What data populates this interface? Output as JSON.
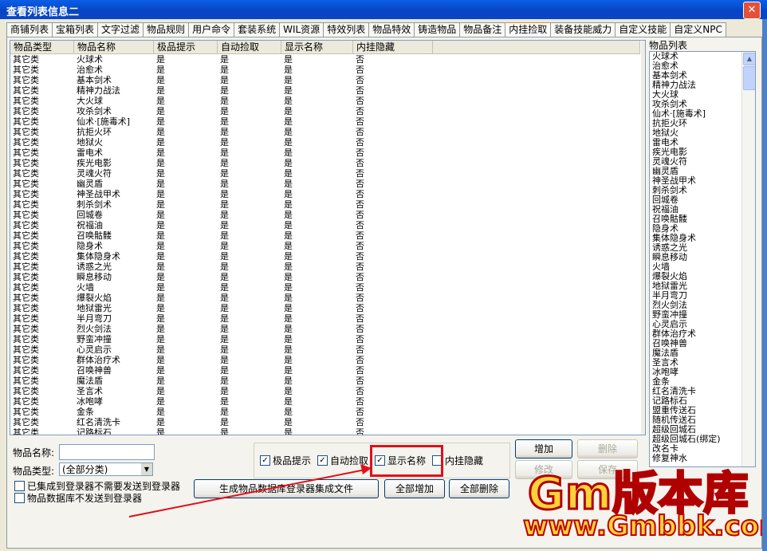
{
  "window": {
    "title": "查看列表信息二",
    "close_label": "✕"
  },
  "tabs": [
    "商铺列表",
    "宝箱列表",
    "文字过滤",
    "物品规则",
    "用户命令",
    "套装系统",
    "WIL资源",
    "特效列表",
    "物品特效",
    "铸造物品",
    "物品备注",
    "内挂捡取",
    "装备技能威力",
    "自定义技能",
    "自定义NPC"
  ],
  "active_tab": "内挂捡取",
  "table": {
    "columns": [
      "物品类型",
      "物品名称",
      "极品提示",
      "自动捡取",
      "显示名称",
      "内挂隐藏"
    ],
    "rows": [
      [
        "其它类",
        "火球术",
        "是",
        "是",
        "是",
        "否"
      ],
      [
        "其它类",
        "治愈术",
        "是",
        "是",
        "是",
        "否"
      ],
      [
        "其它类",
        "基本剑术",
        "是",
        "是",
        "是",
        "否"
      ],
      [
        "其它类",
        "精神力战法",
        "是",
        "是",
        "是",
        "否"
      ],
      [
        "其它类",
        "大火球",
        "是",
        "是",
        "是",
        "否"
      ],
      [
        "其它类",
        "攻杀剑术",
        "是",
        "是",
        "是",
        "否"
      ],
      [
        "其它类",
        "仙术·[施毒术]",
        "是",
        "是",
        "是",
        "否"
      ],
      [
        "其它类",
        "抗拒火环",
        "是",
        "是",
        "是",
        "否"
      ],
      [
        "其它类",
        "地狱火",
        "是",
        "是",
        "是",
        "否"
      ],
      [
        "其它类",
        "雷电术",
        "是",
        "是",
        "是",
        "否"
      ],
      [
        "其它类",
        "疾光电影",
        "是",
        "是",
        "是",
        "否"
      ],
      [
        "其它类",
        "灵魂火符",
        "是",
        "是",
        "是",
        "否"
      ],
      [
        "其它类",
        "幽灵盾",
        "是",
        "是",
        "是",
        "否"
      ],
      [
        "其它类",
        "神圣战甲术",
        "是",
        "是",
        "是",
        "否"
      ],
      [
        "其它类",
        "刺杀剑术",
        "是",
        "是",
        "是",
        "否"
      ],
      [
        "其它类",
        "回城卷",
        "是",
        "是",
        "是",
        "否"
      ],
      [
        "其它类",
        "祝福油",
        "是",
        "是",
        "是",
        "否"
      ],
      [
        "其它类",
        "召唤骷髅",
        "是",
        "是",
        "是",
        "否"
      ],
      [
        "其它类",
        "隐身术",
        "是",
        "是",
        "是",
        "否"
      ],
      [
        "其它类",
        "集体隐身术",
        "是",
        "是",
        "是",
        "否"
      ],
      [
        "其它类",
        "诱惑之光",
        "是",
        "是",
        "是",
        "否"
      ],
      [
        "其它类",
        "瞬息移动",
        "是",
        "是",
        "是",
        "否"
      ],
      [
        "其它类",
        "火墙",
        "是",
        "是",
        "是",
        "否"
      ],
      [
        "其它类",
        "爆裂火焰",
        "是",
        "是",
        "是",
        "否"
      ],
      [
        "其它类",
        "地狱雷光",
        "是",
        "是",
        "是",
        "否"
      ],
      [
        "其它类",
        "半月弯刀",
        "是",
        "是",
        "是",
        "否"
      ],
      [
        "其它类",
        "烈火剑法",
        "是",
        "是",
        "是",
        "否"
      ],
      [
        "其它类",
        "野蛮冲撞",
        "是",
        "是",
        "是",
        "否"
      ],
      [
        "其它类",
        "心灵启示",
        "是",
        "是",
        "是",
        "否"
      ],
      [
        "其它类",
        "群体治疗术",
        "是",
        "是",
        "是",
        "否"
      ],
      [
        "其它类",
        "召唤神兽",
        "是",
        "是",
        "是",
        "否"
      ],
      [
        "其它类",
        "魔法盾",
        "是",
        "是",
        "是",
        "否"
      ],
      [
        "其它类",
        "圣言术",
        "是",
        "是",
        "是",
        "否"
      ],
      [
        "其它类",
        "冰咆哮",
        "是",
        "是",
        "是",
        "否"
      ],
      [
        "其它类",
        "金条",
        "是",
        "是",
        "是",
        "否"
      ],
      [
        "其它类",
        "红名清洗卡",
        "是",
        "是",
        "是",
        "否"
      ],
      [
        "其它类",
        "记路标石",
        "是",
        "是",
        "是",
        "否"
      ]
    ]
  },
  "item_list": {
    "label": "物品列表",
    "items": [
      "火球术",
      "治愈术",
      "基本剑术",
      "精神力战法",
      "大火球",
      "攻杀剑术",
      "仙术·[施毒术]",
      "抗拒火环",
      "地狱火",
      "雷电术",
      "疾光电影",
      "灵魂火符",
      "幽灵盾",
      "神圣战甲术",
      "刺杀剑术",
      "回城卷",
      "祝福油",
      "召唤骷髅",
      "隐身术",
      "集体隐身术",
      "诱惑之光",
      "瞬息移动",
      "火墙",
      "爆裂火焰",
      "地狱雷光",
      "半月弯刀",
      "烈火剑法",
      "野蛮冲撞",
      "心灵启示",
      "群体治疗术",
      "召唤神兽",
      "魔法盾",
      "圣言术",
      "冰咆哮",
      "金条",
      "红名清洗卡",
      "记路标石",
      "盟重传送石",
      "随机传送石",
      "超级回城石",
      "超级回城石(绑定)",
      "改名卡",
      "修复神水"
    ]
  },
  "form": {
    "name_label": "物品名称:",
    "name_value": "",
    "type_label": "物品类型:",
    "type_value": "(全部分类)",
    "check_integrated": "已集成到登录器不需要发送到登录器",
    "check_not_send": "物品数据库不发送到登录器"
  },
  "options": {
    "best": {
      "label": "极品提示",
      "checked": "✓"
    },
    "auto_pick": {
      "label": "自动捡取",
      "checked": "✓"
    },
    "show_name": {
      "label": "显示名称",
      "checked": "✓"
    },
    "hide": {
      "label": "内挂隐藏",
      "checked": ""
    }
  },
  "buttons": {
    "generate": "生成物品数据库登录器集成文件",
    "add_all": "全部增加",
    "delete_all": "全部删除",
    "add": "增加",
    "delete": "删除",
    "modify": "修改",
    "save": "保存"
  },
  "watermark": {
    "line1": "Gm版本库",
    "line2": "www.Gmbbk.com"
  },
  "colors": {
    "title_bar": "#0a5ee6",
    "highlight": "#e0101a",
    "watermark_fill": "#ffd23a",
    "watermark_stroke": "#b00000"
  }
}
